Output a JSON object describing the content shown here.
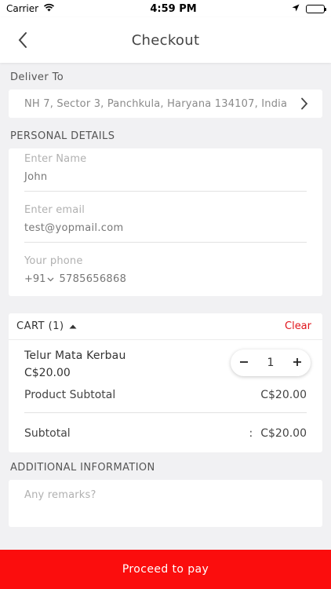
{
  "status_bar": {
    "carrier": "Carrier",
    "time": "4:59 PM"
  },
  "header": {
    "title": "Checkout"
  },
  "deliver": {
    "label": "Deliver To",
    "address": "NH 7, Sector 3, Panchkula, Haryana 134107, India"
  },
  "personal": {
    "label": "PERSONAL DETAILS",
    "name_label": "Enter Name",
    "name_value": "John",
    "email_label": "Enter email",
    "email_value": "test@yopmail.com",
    "phone_label": "Your phone",
    "country_code": "+91",
    "phone_value": "5785656868"
  },
  "cart": {
    "title": "CART (1)",
    "clear_label": "Clear",
    "items": [
      {
        "name": "Telur Mata Kerbau",
        "price": "C$20.00",
        "quantity": "1"
      }
    ],
    "product_subtotal_label": "Product Subtotal",
    "product_subtotal_value": "C$20.00",
    "subtotal_label": "Subtotal",
    "subtotal_separator": ":",
    "subtotal_value": "C$20.00"
  },
  "additional": {
    "label": "ADDITIONAL INFORMATION",
    "remarks_placeholder": "Any remarks?"
  },
  "footer": {
    "pay_label": "Proceed to pay"
  },
  "colors": {
    "accent": "#fb0d0d",
    "clear": "#e0141b"
  }
}
